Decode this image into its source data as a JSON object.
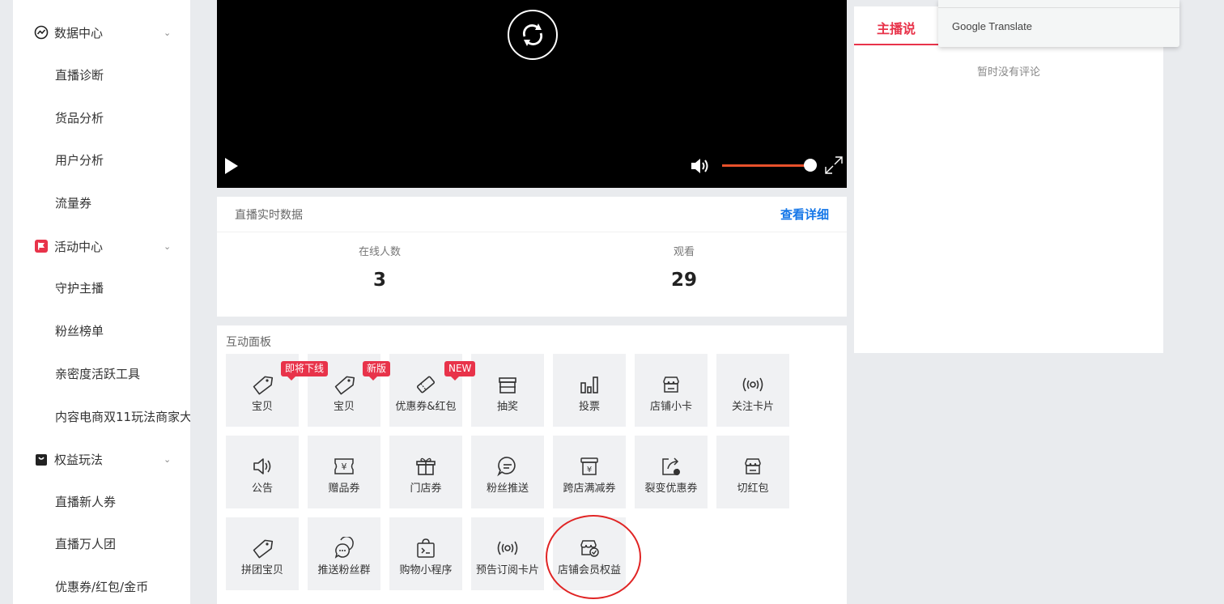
{
  "sidebar": {
    "groups": [
      {
        "label": "数据中心",
        "icon": "chart-circle-icon"
      },
      {
        "label": "活动中心",
        "icon": "flag-icon"
      },
      {
        "label": "权益玩法",
        "icon": "bag-icon"
      }
    ],
    "items": {
      "zhibozhenduan": "直播诊断",
      "huopinfenxi": "货品分析",
      "yonghufenxi": "用户分析",
      "liuliangquan": "流量券",
      "shouhuzhubo": "守护主播",
      "fensibangdan": "粉丝榜单",
      "qinmidu": "亲密度活跃工具",
      "neirongdianshang": "内容电商双11玩法商家大",
      "xinrenquan": "直播新人券",
      "wanrentuan": "直播万人团",
      "youhuiquan": "优惠券/红包/金币"
    }
  },
  "video": {
    "volume_percent": 100
  },
  "stats": {
    "title": "直播实时数据",
    "detail_link": "查看详细",
    "online_label": "在线人数",
    "online_value": "3",
    "views_label": "观看",
    "views_value": "29"
  },
  "panel": {
    "title": "互动面板",
    "tiles": [
      {
        "label": "宝贝",
        "badge": "即将下线",
        "icon": "tag-icon"
      },
      {
        "label": "宝贝",
        "badge": "新版",
        "icon": "tag-icon"
      },
      {
        "label": "优惠券&红包",
        "badge": "NEW",
        "icon": "coupon-icon"
      },
      {
        "label": "抽奖",
        "icon": "gift-box-icon"
      },
      {
        "label": "投票",
        "icon": "bar-chart-icon"
      },
      {
        "label": "店铺小卡",
        "icon": "store-icon"
      },
      {
        "label": "关注卡片",
        "icon": "broadcast-icon"
      },
      {
        "label": "公告",
        "icon": "speaker-icon"
      },
      {
        "label": "赠品券",
        "icon": "ticket-yen-icon"
      },
      {
        "label": "门店券",
        "icon": "present-icon"
      },
      {
        "label": "粉丝推送",
        "icon": "chat-bubble-icon"
      },
      {
        "label": "跨店满减券",
        "icon": "yen-box-icon"
      },
      {
        "label": "裂变优惠券",
        "icon": "share-coupon-icon"
      },
      {
        "label": "切红包",
        "icon": "store-icon"
      },
      {
        "label": "拼团宝贝",
        "icon": "tag-icon"
      },
      {
        "label": "推送粉丝群",
        "icon": "chat-group-icon"
      },
      {
        "label": "购物小程序",
        "icon": "bag-terminal-icon"
      },
      {
        "label": "预告订阅卡片",
        "icon": "broadcast-icon"
      },
      {
        "label": "店铺会员权益",
        "icon": "store-check-icon"
      }
    ]
  },
  "right_panel": {
    "tab_label": "主播说",
    "empty_message": "暂时没有评论"
  },
  "google_translate": {
    "label": "Google Translate"
  },
  "colors": {
    "accent": "#e8334a",
    "link": "#1677e8",
    "volume": "#e8512b"
  }
}
